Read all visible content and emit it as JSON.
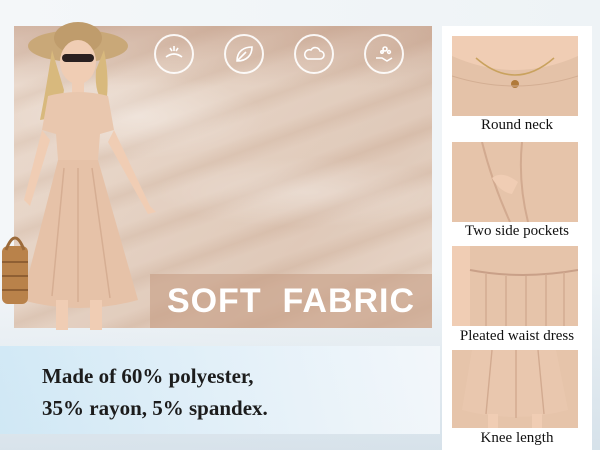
{
  "feature_icons": [
    {
      "icon": "breathable-icon"
    },
    {
      "icon": "leaf-soft-icon"
    },
    {
      "icon": "cloud-comfort-icon"
    },
    {
      "icon": "hand-wash-icon"
    }
  ],
  "banner": {
    "text": "SOFT  FABRIC"
  },
  "material": {
    "line1": "Made of 60% polyester,",
    "line2": "35% rayon, 5% spandex."
  },
  "details": [
    {
      "label": "Round neck"
    },
    {
      "label": "Two side pockets"
    },
    {
      "label": "Pleated waist dress"
    },
    {
      "label": "Knee length"
    }
  ],
  "colors": {
    "fabric": "#e2cdbd",
    "dress": "#e9c7ae",
    "caption_bg": "#d6ebf6"
  }
}
